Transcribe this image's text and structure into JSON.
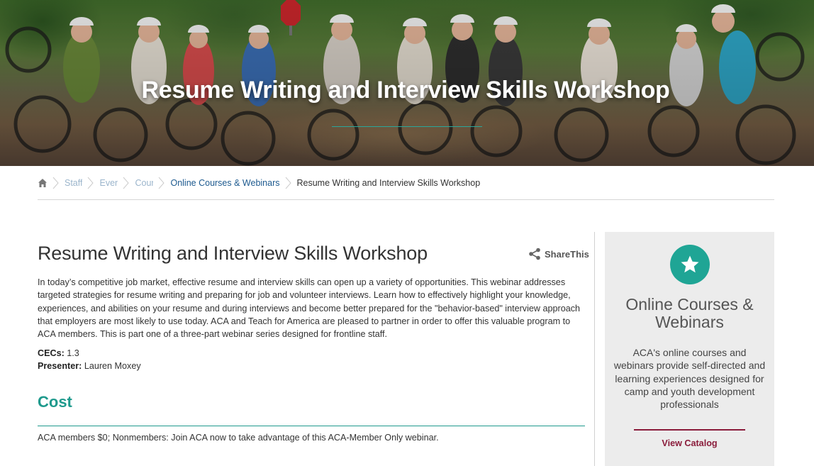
{
  "hero": {
    "title": "Resume Writing and Interview Skills Workshop"
  },
  "breadcrumb": {
    "home_icon": "home-icon",
    "items": [
      {
        "label": "Staff"
      },
      {
        "label": "Even"
      },
      {
        "label": "Cour"
      },
      {
        "label": "Online Courses & Webinars"
      }
    ],
    "current": "Resume Writing and Interview Skills Workshop"
  },
  "main": {
    "title": "Resume Writing and Interview Skills Workshop",
    "share_label": "ShareThis",
    "description": "In today’s competitive job market, effective resume and interview skills can open up a variety of opportunities.  This webinar addresses targeted strategies for resume writing and preparing for job and volunteer interviews.  Learn how to effectively highlight your knowledge, experiences, and abilities on your resume and during interviews and become better prepared for the \"behavior-based\" interview approach that employers are most likely to use today.  ACA and Teach for America are pleased to partner in order to offer this valuable program to ACA members.  This is part one of a three-part webinar series designed for frontline staff.",
    "cecs_label": "CECs:",
    "cecs_value": "1.3",
    "presenter_label": "Presenter:",
    "presenter_value": "Lauren Moxey",
    "cost_heading": "Cost",
    "cost_text": "ACA members $0; Nonmembers: Join ACA now to take advantage of this ACA-Member Only webinar."
  },
  "sidebar": {
    "icon": "star-icon",
    "title": "Online Courses & Webinars",
    "text": "ACA's online courses and webinars provide self-directed and learning experiences designed for camp and youth development professionals",
    "link_label": "View Catalog"
  },
  "colors": {
    "accent_teal": "#1f9a8d",
    "link_blue": "#1d5a8f",
    "catalog_maroon": "#8a1c3b"
  }
}
